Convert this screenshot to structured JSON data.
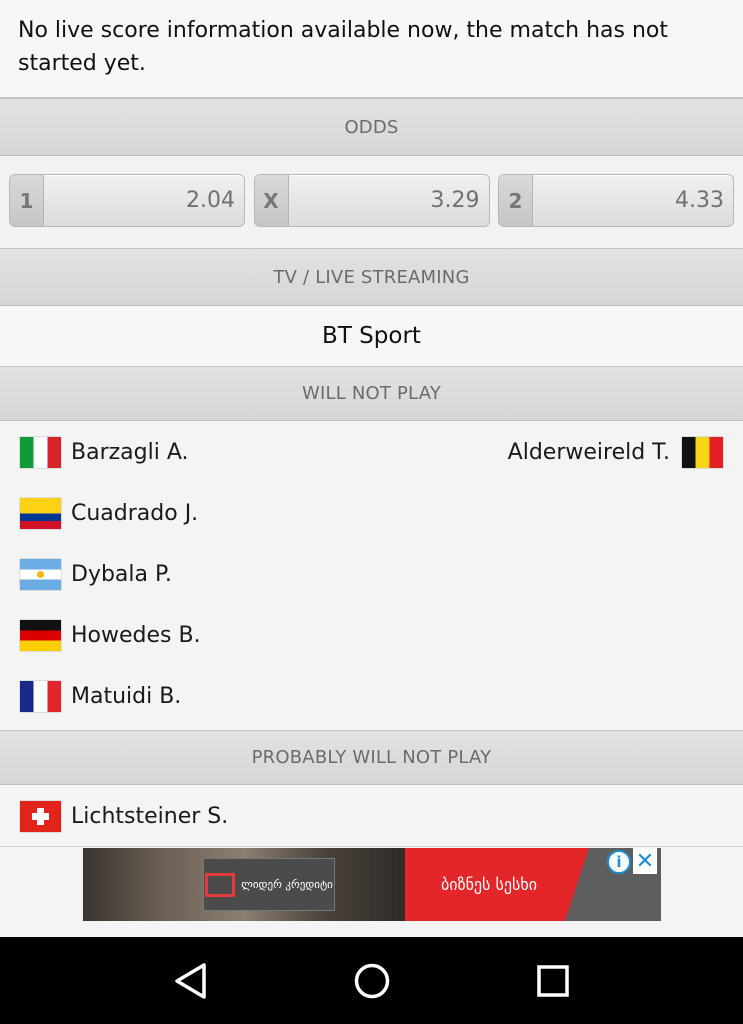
{
  "notice": "No live score information available now, the match has not started yet.",
  "odds": {
    "header": "ODDS",
    "items": [
      {
        "label": "1",
        "value": "2.04"
      },
      {
        "label": "X",
        "value": "3.29"
      },
      {
        "label": "2",
        "value": "4.33"
      }
    ]
  },
  "tv": {
    "header": "TV / LIVE STREAMING",
    "channel": "BT Sport"
  },
  "will_not_play": {
    "header": "WILL NOT PLAY",
    "home": [
      {
        "name": "Barzagli A.",
        "flag": "italy-flag-icon"
      },
      {
        "name": "Cuadrado J.",
        "flag": "colombia-flag-icon"
      },
      {
        "name": "Dybala P.",
        "flag": "argentina-flag-icon"
      },
      {
        "name": "Howedes B.",
        "flag": "germany-flag-icon"
      },
      {
        "name": "Matuidi B.",
        "flag": "france-flag-icon"
      }
    ],
    "away": [
      {
        "name": "Alderweireld T.",
        "flag": "belgium-flag-icon"
      }
    ]
  },
  "probably_will_not_play": {
    "header": "PROBABLY WILL NOT PLAY",
    "home": [
      {
        "name": "Lichtsteiner S.",
        "flag": "switzerland-flag-icon"
      }
    ]
  },
  "ad": {
    "logo_text": "ლიდერ კრედიტი",
    "tagline": "ბიზნეს სესხი",
    "info_icon": "info-icon",
    "close_icon": "close-icon"
  },
  "navbar": {
    "icons": [
      "back-icon",
      "home-icon",
      "recents-icon"
    ]
  },
  "colors": {
    "header_bg": "#d9d9d9",
    "header_text": "#6b6b6b",
    "ad_red": "#e3262a",
    "nav_bg": "#000000"
  }
}
